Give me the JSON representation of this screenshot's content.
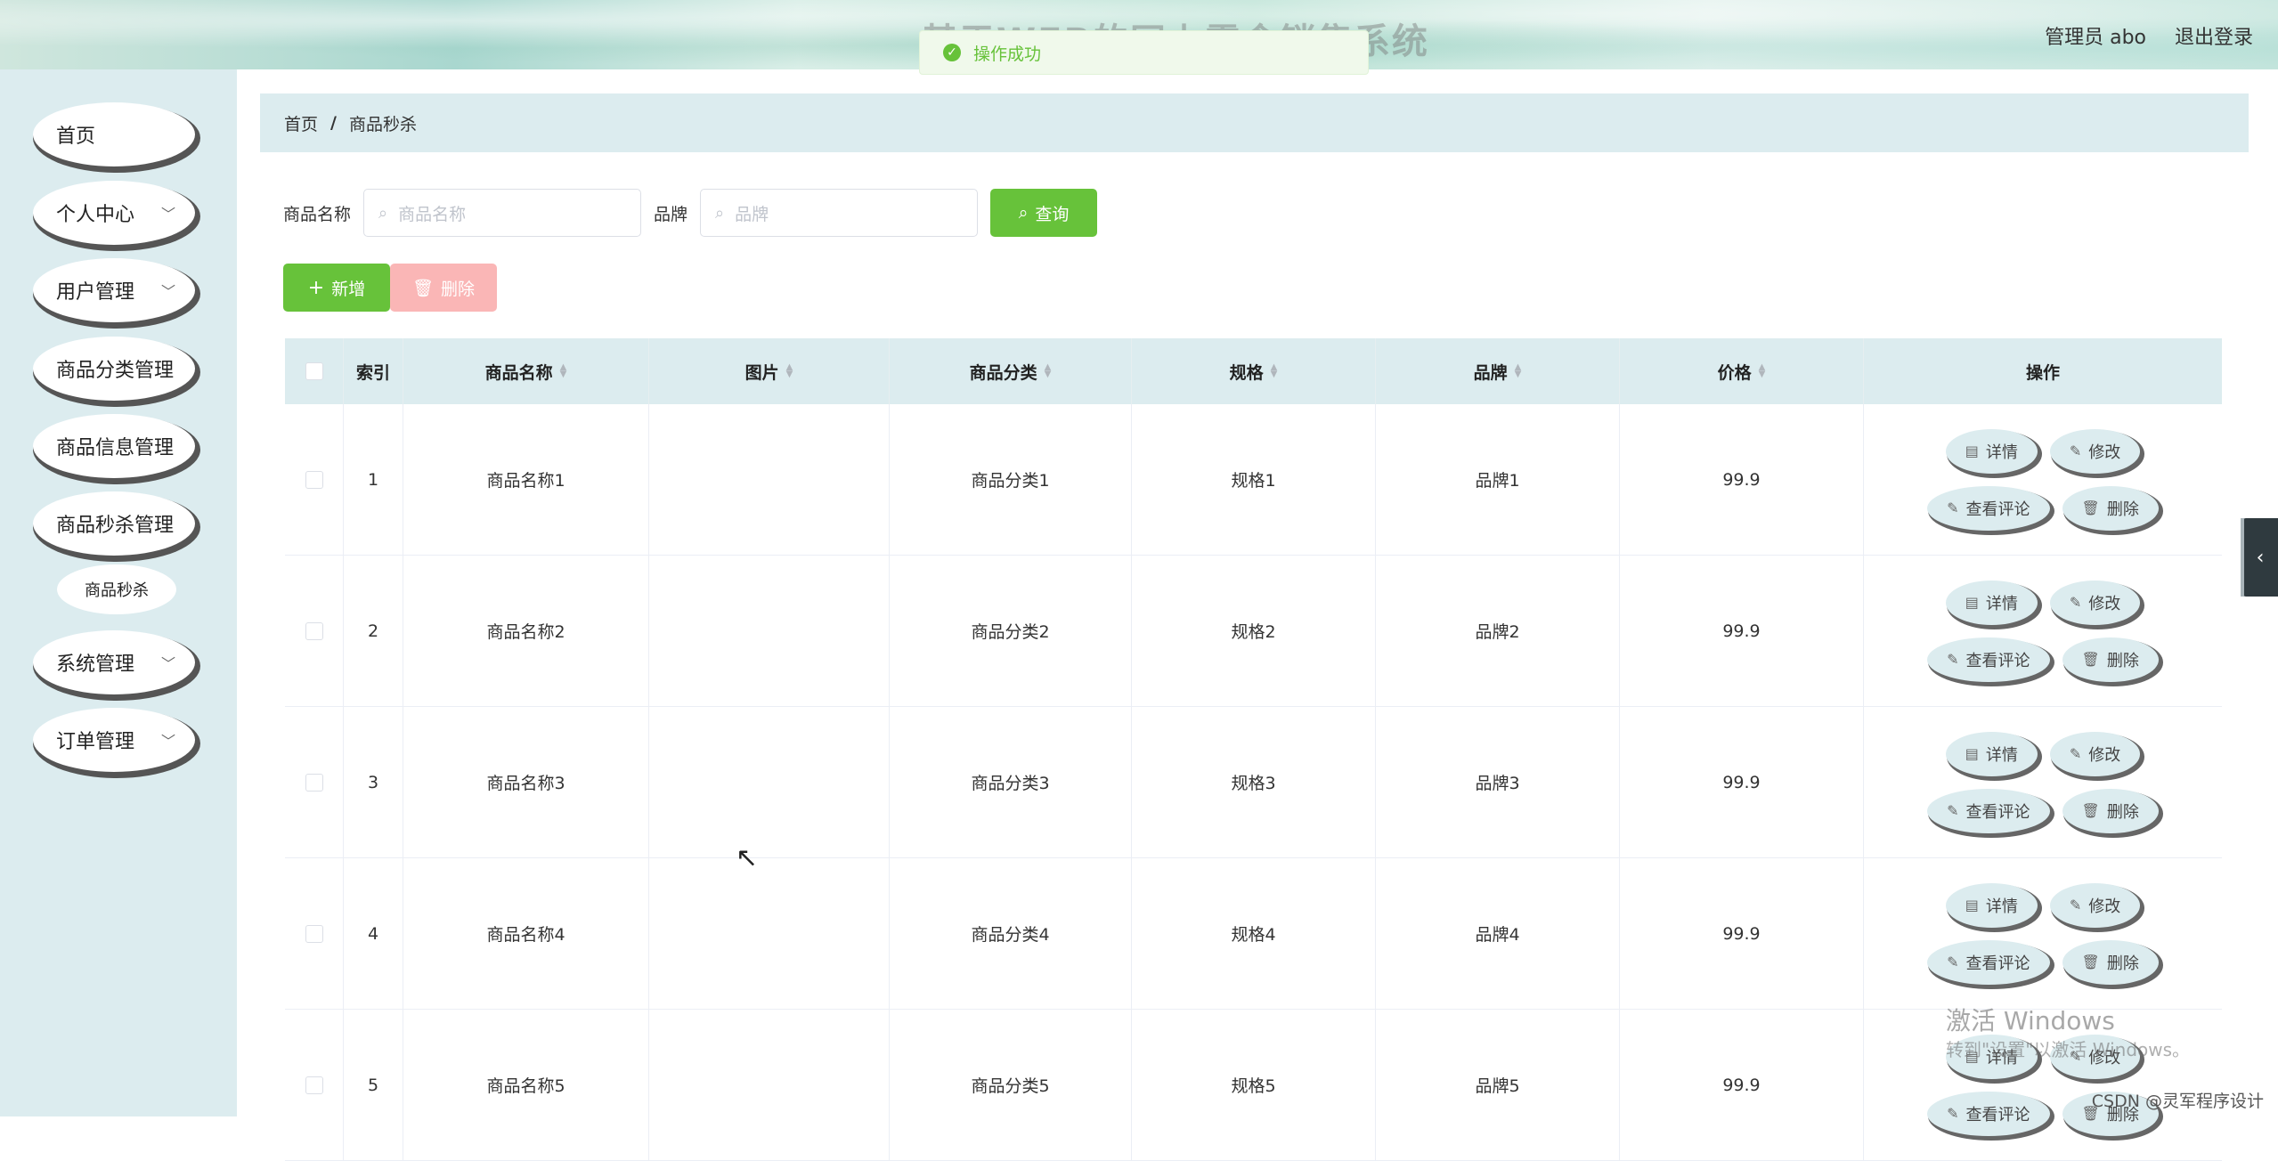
{
  "header": {
    "title": "基于WEB的网上零食销售系统",
    "user": "管理员 abo",
    "logout": "退出登录"
  },
  "toast": {
    "message": "操作成功"
  },
  "sidebar": {
    "items": [
      {
        "label": "首页",
        "has_children": false
      },
      {
        "label": "个人中心",
        "has_children": true
      },
      {
        "label": "用户管理",
        "has_children": true
      },
      {
        "label": "商品分类管理",
        "has_children": false
      },
      {
        "label": "商品信息管理",
        "has_children": false
      },
      {
        "label": "商品秒杀管理",
        "has_children": false
      }
    ],
    "submenu": {
      "label": "商品秒杀"
    },
    "items_after": [
      {
        "label": "系统管理",
        "has_children": true
      },
      {
        "label": "订单管理",
        "has_children": true
      }
    ]
  },
  "breadcrumb": {
    "home": "首页",
    "separator": "/",
    "current": "商品秒杀"
  },
  "search": {
    "name_label": "商品名称",
    "name_placeholder": "商品名称",
    "brand_label": "品牌",
    "brand_placeholder": "品牌",
    "query_button": "查询"
  },
  "actions": {
    "add": "新增",
    "delete": "删除"
  },
  "table": {
    "headers": [
      "索引",
      "商品名称",
      "图片",
      "商品分类",
      "规格",
      "品牌",
      "价格",
      "操作"
    ],
    "rows": [
      {
        "index": "1",
        "name": "商品名称1",
        "category": "商品分类1",
        "spec": "规格1",
        "brand": "品牌1",
        "price": "99.9"
      },
      {
        "index": "2",
        "name": "商品名称2",
        "category": "商品分类2",
        "spec": "规格2",
        "brand": "品牌2",
        "price": "99.9"
      },
      {
        "index": "3",
        "name": "商品名称3",
        "category": "商品分类3",
        "spec": "规格3",
        "brand": "品牌3",
        "price": "99.9"
      },
      {
        "index": "4",
        "name": "商品名称4",
        "category": "商品分类4",
        "spec": "规格4",
        "brand": "品牌4",
        "price": "99.9"
      },
      {
        "index": "5",
        "name": "商品名称5",
        "category": "商品分类5",
        "spec": "规格5",
        "brand": "品牌5",
        "price": "99.9"
      }
    ],
    "row_actions": {
      "detail": "详情",
      "edit": "修改",
      "comments": "查看评论",
      "delete": "删除"
    }
  },
  "watermark": {
    "line1": "激活 Windows",
    "line2": "转到\"设置\"以激活 Windows。",
    "csdn": "CSDN @灵军程序设计"
  },
  "colors": {
    "primary": "#67c23a",
    "danger_disabled": "#fab6b6",
    "sidebar_bg": "#dcecef"
  }
}
